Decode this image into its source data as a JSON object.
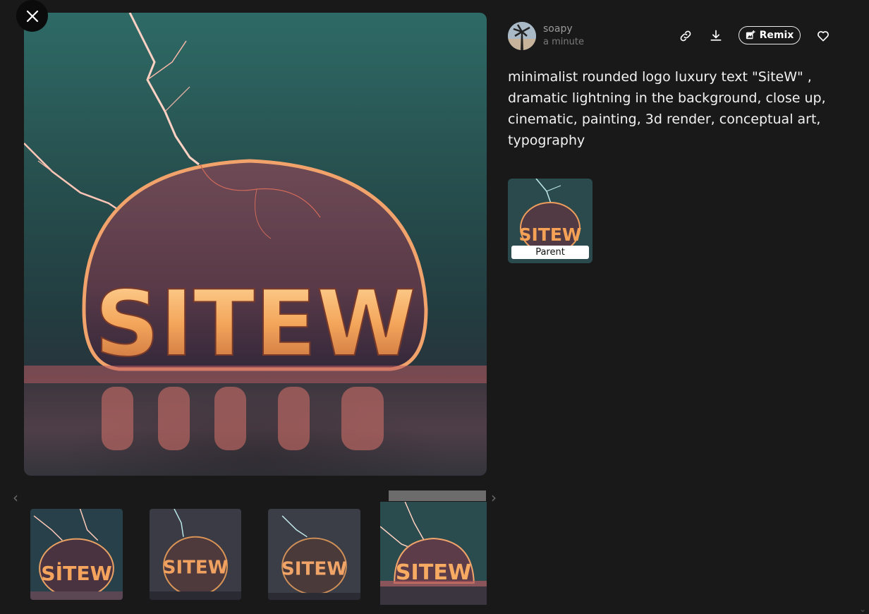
{
  "viewer": {
    "close_label": "Close",
    "main_image_text": "SITEW"
  },
  "user": {
    "name": "soapy",
    "timestamp": "a minute"
  },
  "actions": {
    "remix_label": "Remix",
    "copy_link_icon": "link-icon",
    "download_icon": "download-icon",
    "like_icon": "heart-icon"
  },
  "prompt": {
    "text": "minimalist rounded logo luxury text \"SiteW\" , dramatic lightning in the background, close up, cinematic, painting, 3d render, conceptual art, typography"
  },
  "parent": {
    "label": "Parent",
    "image_text": "SITEW"
  },
  "thumbnails": [
    {
      "text": "SİTEW"
    },
    {
      "text": "SITEW"
    },
    {
      "text": "SITEW"
    },
    {
      "text": "SITEW"
    }
  ],
  "colors": {
    "background": "#191919",
    "text": "#ffffff",
    "muted": "#9a9a9a"
  }
}
